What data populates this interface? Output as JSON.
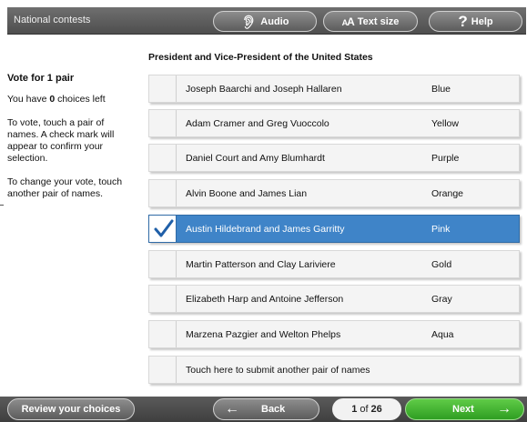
{
  "header": {
    "contest_group": "National contests",
    "audio_label": "Audio",
    "text_size_label": "Text size",
    "help_label": "Help"
  },
  "contest": {
    "title": "President and Vice-President of the United States"
  },
  "sidebar": {
    "vote_for": "Vote for 1 pair",
    "choices_prefix": "You have ",
    "choices_count": "0",
    "choices_suffix": " choices left",
    "instruction_vote": "To vote, touch a pair of names. A check mark will appear to confirm your selection.",
    "instruction_change": "To change your vote, touch another pair of names."
  },
  "candidates": [
    {
      "names": "Joseph Baarchi and Joseph Hallaren",
      "party": "Blue",
      "selected": false
    },
    {
      "names": "Adam Cramer and Greg Vuoccolo",
      "party": "Yellow",
      "selected": false
    },
    {
      "names": "Daniel Court and Amy Blumhardt",
      "party": "Purple",
      "selected": false
    },
    {
      "names": "Alvin Boone and James Lian",
      "party": "Orange",
      "selected": false
    },
    {
      "names": "Austin Hildebrand and James Garritty",
      "party": "Pink",
      "selected": true
    },
    {
      "names": "Martin Patterson and Clay Lariviere",
      "party": "Gold",
      "selected": false
    },
    {
      "names": "Elizabeth Harp and Antoine Jefferson",
      "party": "Gray",
      "selected": false
    },
    {
      "names": "Marzena Pazgier and Welton Phelps",
      "party": "Aqua",
      "selected": false
    }
  ],
  "write_in": {
    "label": "Touch here to submit another pair of names"
  },
  "footer": {
    "review_label": "Review your choices",
    "back_label": "Back",
    "page_current": "1",
    "page_of": "of",
    "page_total": "26",
    "next_label": "Next"
  },
  "colors": {
    "selected_row": "#3f84c8",
    "next_button": "#3fb52c",
    "check_mark": "#1f5fa8"
  },
  "icons": {
    "audio": "ear-icon",
    "text_size": "text-size-icon",
    "help": "question-mark-icon",
    "back": "left-arrow-icon",
    "next": "right-arrow-icon",
    "check": "check-mark-icon"
  }
}
